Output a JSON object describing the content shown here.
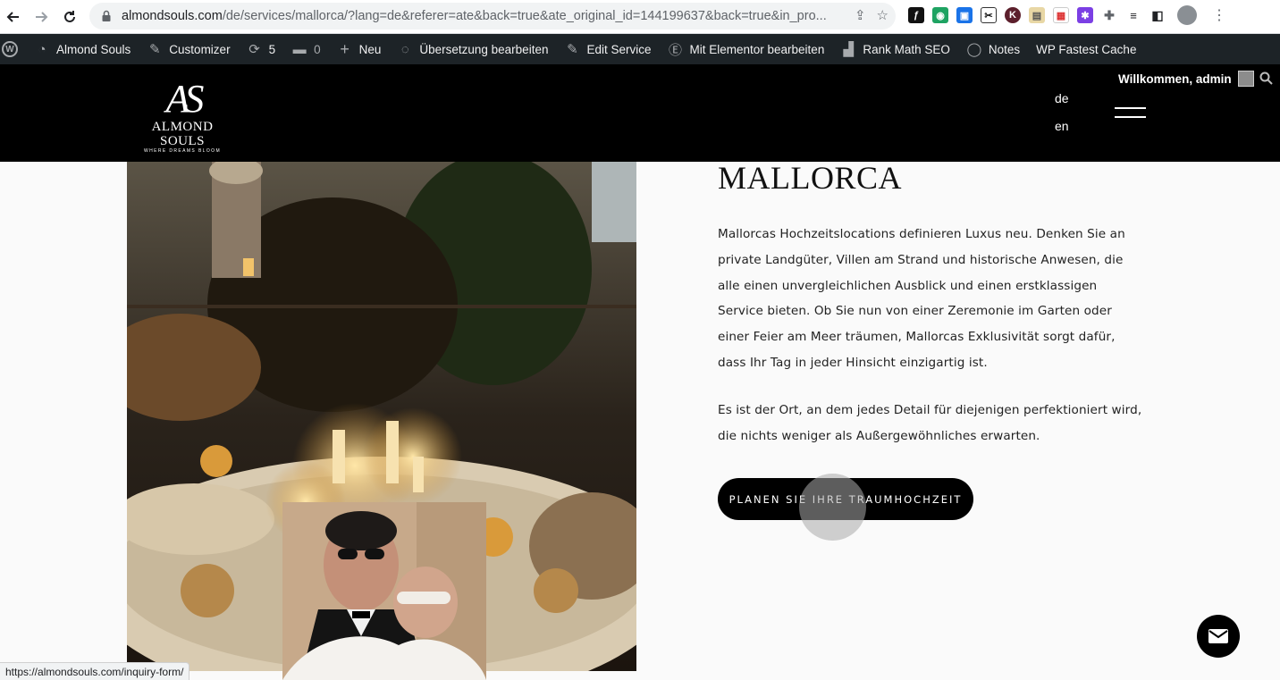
{
  "browser": {
    "url_host": "almondsouls.com",
    "url_path": "/de/services/mallorca/?lang=de&referer=ate&back=true&ate_original_id=144199637&back=true&in_pro..."
  },
  "admin_bar": {
    "site_name": "Almond Souls",
    "customizer": "Customizer",
    "updates_count": "5",
    "comments_count": "0",
    "new_label": "Neu",
    "translate_label": "Übersetzung bearbeiten",
    "edit_service_label": "Edit Service",
    "elementor_label": "Mit Elementor bearbeiten",
    "rankmath_label": "Rank Math SEO",
    "notes_label": "Notes",
    "cache_label": "WP Fastest Cache"
  },
  "header": {
    "logo_monogram": "AS",
    "logo_name": "ALMOND SOULS",
    "logo_tagline": "WHERE DREAMS BLOOM",
    "lang_de": "de",
    "lang_en": "en",
    "welcome": "Willkommen, admin"
  },
  "content": {
    "heading": "MALLORCA",
    "paragraph1": "Mallorcas Hochzeitslocations definieren Luxus neu. Denken Sie an private Landgüter, Villen am Strand und historische Anwesen, die alle einen unvergleichlichen Ausblick und einen erstklassigen Service bieten. Ob Sie nun von einer Zeremonie im Garten oder einer Feier am Meer träumen, Mallorcas Exklusivität sorgt dafür, dass Ihr Tag in jeder Hinsicht einzigartig ist.",
    "paragraph2": "Es ist der Ort, an dem jedes Detail für diejenigen perfektioniert wird, die nichts weniger als Außergewöhnliches erwarten.",
    "cta_label": "PLANEN SIE IHRE TRAUMHOCHZEIT"
  },
  "status_bar": {
    "hover_url": "https://almondsouls.com/inquiry-form/"
  },
  "colors": {
    "header_bg": "#000000",
    "admin_bar_bg": "#1d2327",
    "page_bg": "#fafafa",
    "button_bg": "#000000"
  }
}
